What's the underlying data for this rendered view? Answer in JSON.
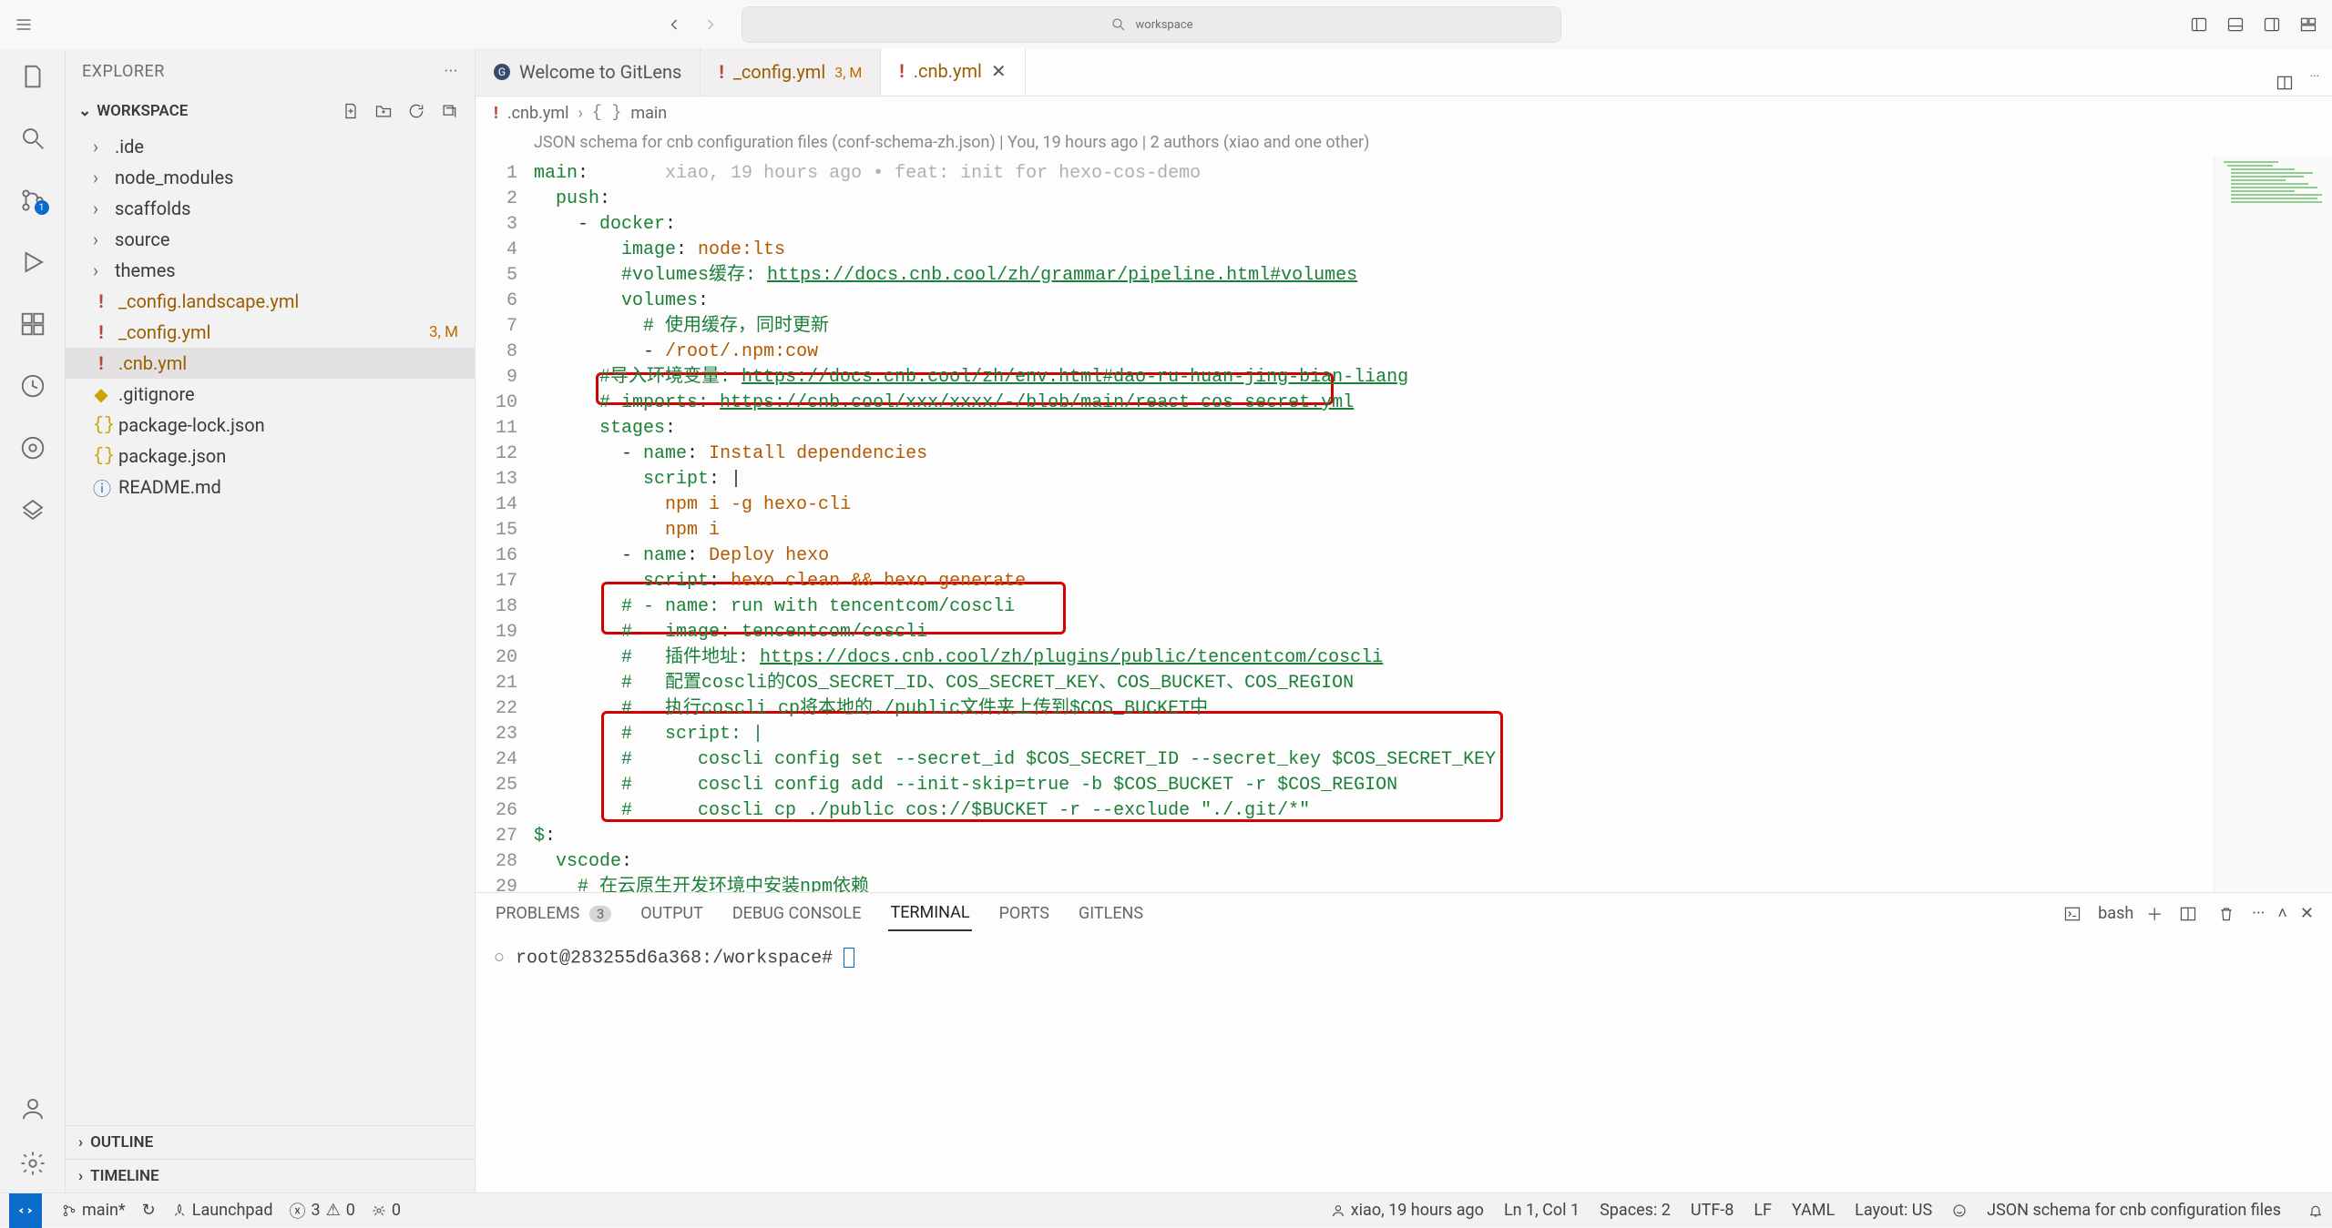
{
  "titlebar": {
    "search_placeholder": "workspace"
  },
  "sidebar": {
    "title": "EXPLORER",
    "workspace_label": "WORKSPACE",
    "outline_label": "OUTLINE",
    "timeline_label": "TIMELINE",
    "tree": [
      {
        "type": "folder",
        "name": ".ide"
      },
      {
        "type": "folder",
        "name": "node_modules"
      },
      {
        "type": "folder",
        "name": "scaffolds"
      },
      {
        "type": "folder",
        "name": "source"
      },
      {
        "type": "folder",
        "name": "themes"
      },
      {
        "type": "file",
        "name": "_config.landscape.yml",
        "icon": "yaml",
        "modified": true
      },
      {
        "type": "file",
        "name": "_config.yml",
        "icon": "yaml",
        "modified": true,
        "status": "3, M"
      },
      {
        "type": "file",
        "name": ".cnb.yml",
        "icon": "yaml",
        "modified": true,
        "selected": true
      },
      {
        "type": "file",
        "name": ".gitignore",
        "icon": "git"
      },
      {
        "type": "file",
        "name": "package-lock.json",
        "icon": "json"
      },
      {
        "type": "file",
        "name": "package.json",
        "icon": "json"
      },
      {
        "type": "file",
        "name": "README.md",
        "icon": "info"
      }
    ]
  },
  "activitybar": {
    "scm_badge": "1"
  },
  "tabs": [
    {
      "label": "Welcome to GitLens",
      "icon": "gitlens"
    },
    {
      "label": "_config.yml",
      "icon": "yaml",
      "badge": "3, M",
      "modified": true
    },
    {
      "label": ".cnb.yml",
      "icon": "yaml",
      "active": true,
      "modified": true,
      "close": true
    }
  ],
  "breadcrumb": {
    "icon": "yaml",
    "file": ".cnb.yml",
    "symbol_icon": "braces",
    "symbol": "main"
  },
  "schema_hint": "JSON schema for cnb configuration files (conf-schema-zh.json) | You, 19 hours ago | 2 authors (xiao and one other)",
  "code": {
    "lines": [
      {
        "n": 1,
        "html": "<span class='tok-key'>main</span><span class='tok-plain'>:</span>       <span class='blame-inline'>xiao, 19 hours ago • feat: init for hexo-cos-demo</span>"
      },
      {
        "n": 2,
        "html": "  <span class='tok-key'>push</span><span class='tok-plain'>:</span>"
      },
      {
        "n": 3,
        "html": "    <span class='tok-plain'>- </span><span class='tok-key'>docker</span><span class='tok-plain'>:</span>"
      },
      {
        "n": 4,
        "html": "        <span class='tok-key'>image</span><span class='tok-plain'>: </span><span class='tok-str'>node:lts</span>"
      },
      {
        "n": 5,
        "html": "        <span class='tok-cmt'>#volumes缓存: </span><span class='tok-link'>https://docs.cnb.cool/zh/grammar/pipeline.html#volumes</span>"
      },
      {
        "n": 6,
        "html": "        <span class='tok-key'>volumes</span><span class='tok-plain'>:</span>"
      },
      {
        "n": 7,
        "html": "          <span class='tok-cmt'># 使用缓存，同时更新</span>"
      },
      {
        "n": 8,
        "html": "          <span class='tok-plain'>- </span><span class='tok-str'>/root/.npm:cow</span>"
      },
      {
        "n": 9,
        "html": "      <span class='tok-cmt'>#导入环境变量: </span><span class='tok-link'>https://docs.cnb.cool/zh/env.html#dao-ru-huan-jing-bian-liang</span>"
      },
      {
        "n": 10,
        "html": "      <span class='tok-cmt'># imports: </span><span class='tok-link'>https://cnb.cool/xxx/xxxx/-/blob/main/react_cos_secret.yml</span>"
      },
      {
        "n": 11,
        "html": "      <span class='tok-key'>stages</span><span class='tok-plain'>:</span>"
      },
      {
        "n": 12,
        "html": "        <span class='tok-plain'>- </span><span class='tok-key'>name</span><span class='tok-plain'>: </span><span class='tok-str'>Install dependencies</span>"
      },
      {
        "n": 13,
        "html": "          <span class='tok-key'>script</span><span class='tok-plain'>: |</span>"
      },
      {
        "n": 14,
        "html": "            <span class='tok-str'>npm i -g hexo-cli</span>"
      },
      {
        "n": 15,
        "html": "            <span class='tok-str'>npm i</span>"
      },
      {
        "n": 16,
        "html": "        <span class='tok-plain'>- </span><span class='tok-key'>name</span><span class='tok-plain'>: </span><span class='tok-str'>Deploy hexo</span>"
      },
      {
        "n": 17,
        "html": "          <span class='tok-key'>script</span><span class='tok-plain'>: </span><span class='tok-str'>hexo clean && hexo generate</span>"
      },
      {
        "n": 18,
        "html": "        <span class='tok-cmt'># - name: run with tencentcom/coscli</span>"
      },
      {
        "n": 19,
        "html": "        <span class='tok-cmt'>#   image: tencentcom/coscli</span>"
      },
      {
        "n": 20,
        "html": "        <span class='tok-cmt'>#   插件地址: </span><span class='tok-link'>https://docs.cnb.cool/zh/plugins/public/tencentcom/coscli</span>"
      },
      {
        "n": 21,
        "html": "        <span class='tok-cmt'>#   配置coscli的COS_SECRET_ID、COS_SECRET_KEY、COS_BUCKET、COS_REGION</span>"
      },
      {
        "n": 22,
        "html": "        <span class='tok-cmt'>#   执行coscli cp将本地的./public文件夹上传到$COS_BUCKET中</span>"
      },
      {
        "n": 23,
        "html": "        <span class='tok-cmt'>#   script: |</span>"
      },
      {
        "n": 24,
        "html": "        <span class='tok-cmt'>#      coscli config set --secret_id $COS_SECRET_ID --secret_key $COS_SECRET_KEY</span>"
      },
      {
        "n": 25,
        "html": "        <span class='tok-cmt'>#      coscli config add --init-skip=true -b $COS_BUCKET -r $COS_REGION</span>"
      },
      {
        "n": 26,
        "html": "        <span class='tok-cmt'>#      coscli cp ./public cos://$BUCKET -r --exclude \"./.git/*\"</span>"
      },
      {
        "n": 27,
        "html": "<span class='tok-key'>$</span><span class='tok-plain'>:</span>"
      },
      {
        "n": 28,
        "html": "  <span class='tok-key'>vscode</span><span class='tok-plain'>:</span>"
      },
      {
        "n": 29,
        "html": "    <span class='tok-cmt'># 在云原生开发环境中安装npm依赖</span>"
      }
    ]
  },
  "panel": {
    "tabs": {
      "problems": "PROBLEMS",
      "problems_count": "3",
      "output": "OUTPUT",
      "debug": "DEBUG CONSOLE",
      "terminal": "TERMINAL",
      "ports": "PORTS",
      "gitlens": "GITLENS"
    },
    "terminal_label": "bash",
    "terminal_line": "root@283255d6a368:/workspace# "
  },
  "statusbar": {
    "branch": "main*",
    "sync": "↻",
    "launchpad": "Launchpad",
    "problems": "3",
    "warnings": "0",
    "ports": "0",
    "blame": "xiao, 19 hours ago",
    "position": "Ln 1, Col 1",
    "spaces": "Spaces: 2",
    "encoding": "UTF-8",
    "eol": "LF",
    "lang": "YAML",
    "layout": "Layout: US",
    "schema": "JSON schema for cnb configuration files"
  }
}
